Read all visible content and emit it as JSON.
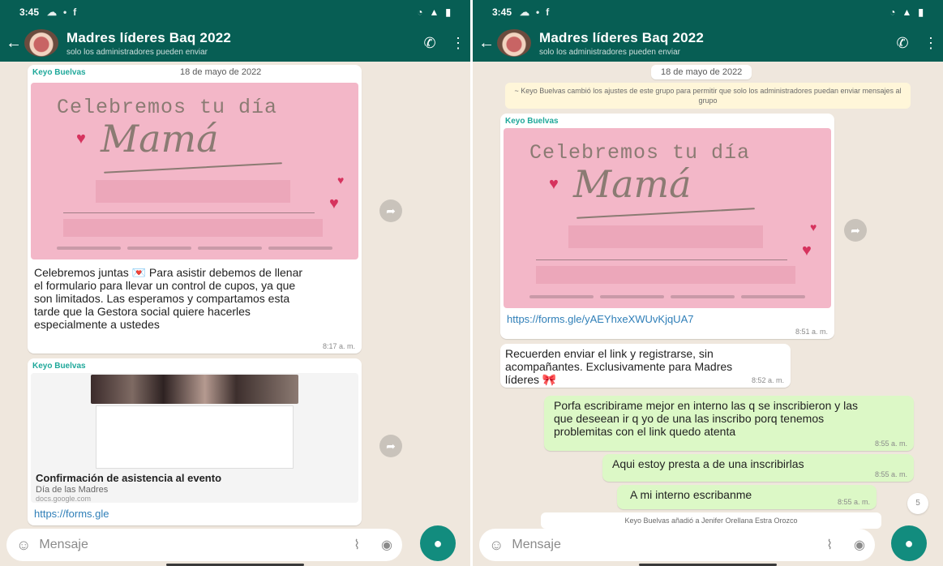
{
  "colors": {
    "header": "#075e54",
    "accent": "#128c7e",
    "chat_bg": "#efe7dd",
    "outgoing": "#dcf8c6",
    "sender": "#1fa89a"
  },
  "status": {
    "time": "3:45"
  },
  "chat": {
    "title": "Madres líderes Baq 2022",
    "subtitle": "solo los administradores pueden enviar",
    "input_placeholder": "Mensaje"
  },
  "icons": {
    "back": "arrow-left-icon",
    "call": "add-call-icon",
    "menu": "more-vertical-icon",
    "emoji": "emoji-icon",
    "attach": "paperclip-icon",
    "camera": "camera-icon",
    "mic": "microphone-icon",
    "forward": "forward-icon"
  },
  "left": {
    "date_pill": "18 de mayo de 2022",
    "msg1": {
      "sender": "Keyo Buelvas",
      "poster_line1": "Celebremos tu día",
      "poster_line2": "Mamá",
      "text": "Celebremos juntas 💌 Para asistir debemos de llenar el formulario para llevar un control de cupos, ya que son limitados. Las esperamos y compartamos esta tarde que la Gestora social quiere hacerles especialmente a ustedes",
      "time": "8:17 a. m."
    },
    "msg2": {
      "sender": "Keyo Buelvas",
      "preview_title": "Confirmación de asistencia al evento",
      "preview_desc": "Día de las Madres",
      "preview_domain": "docs.google.com",
      "link": "https://forms.gle"
    }
  },
  "right": {
    "date_pill": "18 de mayo de 2022",
    "system_msg": "~ Keyo Buelvas cambió los ajustes de este grupo para permitir que solo los administradores puedan enviar mensajes al grupo",
    "msg1": {
      "sender": "Keyo Buelvas",
      "poster_line1": "Celebremos tu día",
      "poster_line2": "Mamá",
      "link": "https://forms.gle/yAEYhxeXWUvKjqUA7",
      "time": "8:51 a. m."
    },
    "msg2": {
      "text": "Recuerden enviar el link y registrarse, sin acompañantes. Exclusivamente para Madres líderes 🎀",
      "time": "8:52 a. m."
    },
    "out1": {
      "text": "Porfa escribirame mejor en interno las q se inscribieron y las que deseean ir q yo de una las inscribo porq tenemos problemitas con el link quedo atenta",
      "time": "8:55 a. m."
    },
    "out2": {
      "text": "Aqui estoy presta a de una inscribirlas",
      "time": "8:55 a. m."
    },
    "out3": {
      "text": "A mi interno escribanme",
      "time": "8:55 a. m."
    },
    "system_msg2": "Keyo Buelvas añadió a Jenifer Orellana Estra Orozco",
    "scroll_badge": "5"
  }
}
